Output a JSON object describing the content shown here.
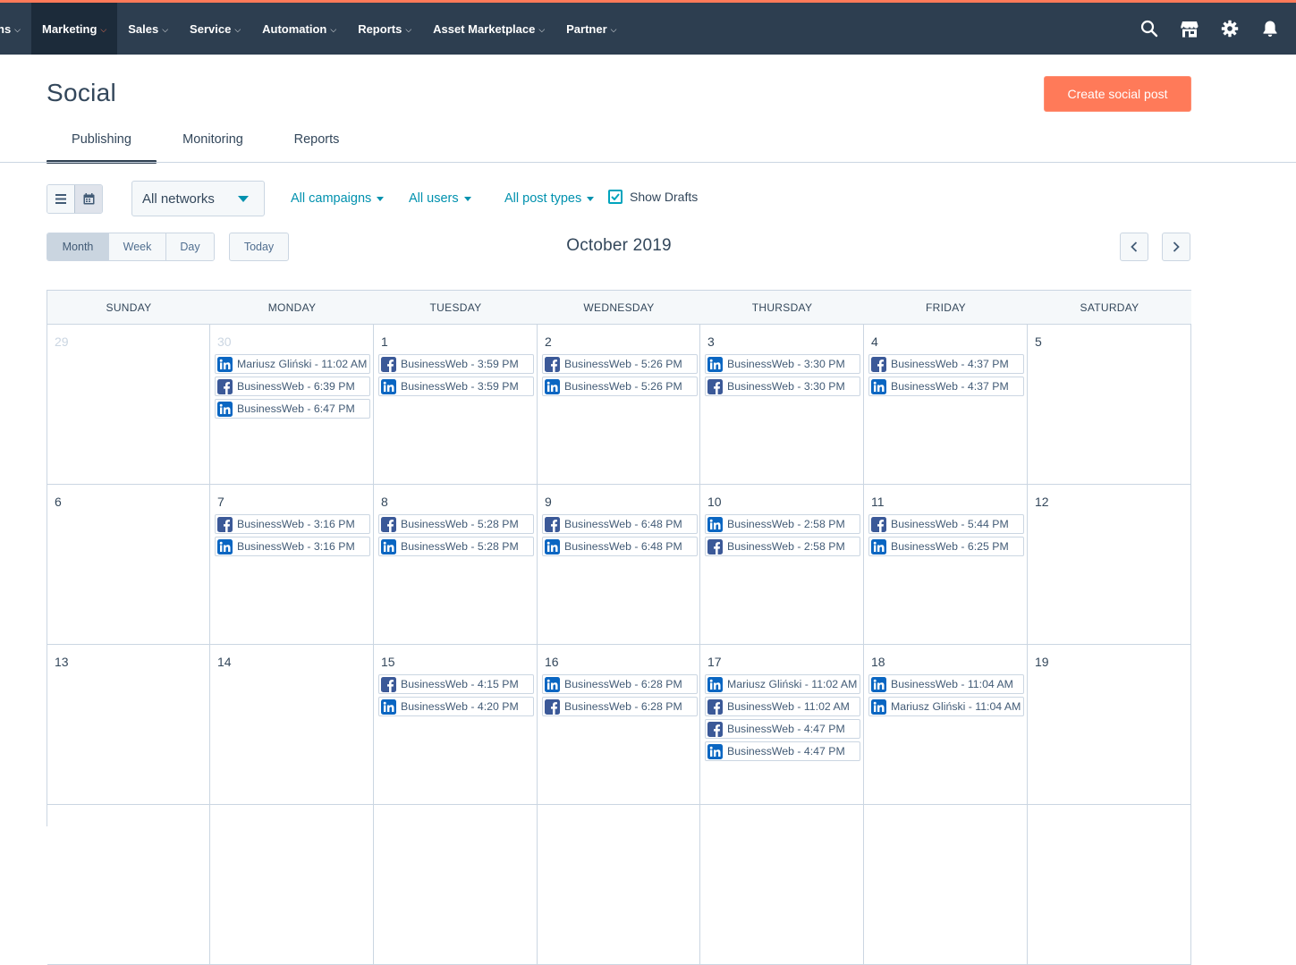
{
  "nav": {
    "items": [
      {
        "label": "ns",
        "name": "nav-item-prev"
      },
      {
        "label": "Marketing",
        "name": "nav-item-marketing"
      },
      {
        "label": "Sales",
        "name": "nav-item-sales"
      },
      {
        "label": "Service",
        "name": "nav-item-service"
      },
      {
        "label": "Automation",
        "name": "nav-item-automation"
      },
      {
        "label": "Reports",
        "name": "nav-item-reports"
      },
      {
        "label": "Asset Marketplace",
        "name": "nav-item-asset-marketplace"
      },
      {
        "label": "Partner",
        "name": "nav-item-partner"
      }
    ],
    "active": "Marketing",
    "icons": [
      "search-icon",
      "marketplace-icon",
      "settings-gear-icon",
      "notifications-bell-icon"
    ],
    "caret": "⌵"
  },
  "colors": {
    "nav_bg": "#2d3e50",
    "accent": "#ff7a59",
    "link": "#0091ae",
    "linkedin": "#0a66c2",
    "facebook": "#3b5998"
  },
  "page": {
    "title": "Social",
    "create_button": "Create social post",
    "tabs": [
      "Publishing",
      "Monitoring",
      "Reports"
    ],
    "active_tab": "Publishing"
  },
  "filters": {
    "network": "All networks",
    "campaigns": "All campaigns",
    "users": "All users",
    "post_types": "All post types",
    "show_drafts": {
      "label": "Show Drafts",
      "checked": true
    }
  },
  "calendar": {
    "views": [
      "Month",
      "Week",
      "Day"
    ],
    "active_view": "Month",
    "today_label": "Today",
    "title": "October 2019",
    "weekdays": [
      "SUNDAY",
      "MONDAY",
      "TUESDAY",
      "WEDNESDAY",
      "THURSDAY",
      "FRIDAY",
      "SATURDAY"
    ],
    "weeks": [
      [
        {
          "day": "29",
          "muted": true,
          "posts": []
        },
        {
          "day": "30",
          "muted": true,
          "posts": [
            {
              "network": "linkedin",
              "text": "Mariusz Gliński - 11:02 AM"
            },
            {
              "network": "facebook",
              "text": "BusinessWeb - 6:39 PM"
            },
            {
              "network": "linkedin",
              "text": "BusinessWeb - 6:47 PM"
            }
          ]
        },
        {
          "day": "1",
          "posts": [
            {
              "network": "facebook",
              "text": "BusinessWeb - 3:59 PM"
            },
            {
              "network": "linkedin",
              "text": "BusinessWeb - 3:59 PM"
            }
          ]
        },
        {
          "day": "2",
          "posts": [
            {
              "network": "facebook",
              "text": "BusinessWeb - 5:26 PM"
            },
            {
              "network": "linkedin",
              "text": "BusinessWeb - 5:26 PM"
            }
          ]
        },
        {
          "day": "3",
          "posts": [
            {
              "network": "linkedin",
              "text": "BusinessWeb - 3:30 PM"
            },
            {
              "network": "facebook",
              "text": "BusinessWeb - 3:30 PM"
            }
          ]
        },
        {
          "day": "4",
          "posts": [
            {
              "network": "facebook",
              "text": "BusinessWeb - 4:37 PM"
            },
            {
              "network": "linkedin",
              "text": "BusinessWeb - 4:37 PM"
            }
          ]
        },
        {
          "day": "5",
          "posts": []
        }
      ],
      [
        {
          "day": "6",
          "posts": []
        },
        {
          "day": "7",
          "posts": [
            {
              "network": "facebook",
              "text": "BusinessWeb - 3:16 PM"
            },
            {
              "network": "linkedin",
              "text": "BusinessWeb - 3:16 PM"
            }
          ]
        },
        {
          "day": "8",
          "posts": [
            {
              "network": "facebook",
              "text": "BusinessWeb - 5:28 PM"
            },
            {
              "network": "linkedin",
              "text": "BusinessWeb - 5:28 PM"
            }
          ]
        },
        {
          "day": "9",
          "posts": [
            {
              "network": "facebook",
              "text": "BusinessWeb - 6:48 PM"
            },
            {
              "network": "linkedin",
              "text": "BusinessWeb - 6:48 PM"
            }
          ]
        },
        {
          "day": "10",
          "posts": [
            {
              "network": "linkedin",
              "text": "BusinessWeb - 2:58 PM"
            },
            {
              "network": "facebook",
              "text": "BusinessWeb - 2:58 PM"
            }
          ]
        },
        {
          "day": "11",
          "posts": [
            {
              "network": "facebook",
              "text": "BusinessWeb - 5:44 PM"
            },
            {
              "network": "linkedin",
              "text": "BusinessWeb - 6:25 PM"
            }
          ]
        },
        {
          "day": "12",
          "posts": []
        }
      ],
      [
        {
          "day": "13",
          "posts": []
        },
        {
          "day": "14",
          "posts": []
        },
        {
          "day": "15",
          "posts": [
            {
              "network": "facebook",
              "text": "BusinessWeb - 4:15 PM"
            },
            {
              "network": "linkedin",
              "text": "BusinessWeb - 4:20 PM"
            }
          ]
        },
        {
          "day": "16",
          "posts": [
            {
              "network": "linkedin",
              "text": "BusinessWeb - 6:28 PM"
            },
            {
              "network": "facebook",
              "text": "BusinessWeb - 6:28 PM"
            }
          ]
        },
        {
          "day": "17",
          "posts": [
            {
              "network": "linkedin",
              "text": "Mariusz Gliński - 11:02 AM"
            },
            {
              "network": "facebook",
              "text": "BusinessWeb - 11:02 AM"
            },
            {
              "network": "facebook",
              "text": "BusinessWeb - 4:47 PM"
            },
            {
              "network": "linkedin",
              "text": "BusinessWeb - 4:47 PM"
            }
          ]
        },
        {
          "day": "18",
          "posts": [
            {
              "network": "linkedin",
              "text": "BusinessWeb - 11:04 AM"
            },
            {
              "network": "linkedin",
              "text": "Mariusz Gliński - 11:04 AM"
            }
          ]
        },
        {
          "day": "19",
          "posts": []
        }
      ],
      [
        {
          "day": "",
          "posts": []
        },
        {
          "day": "",
          "posts": []
        },
        {
          "day": "",
          "posts": []
        },
        {
          "day": "",
          "posts": []
        },
        {
          "day": "",
          "posts": []
        },
        {
          "day": "",
          "posts": []
        },
        {
          "day": "",
          "posts": []
        }
      ]
    ]
  }
}
